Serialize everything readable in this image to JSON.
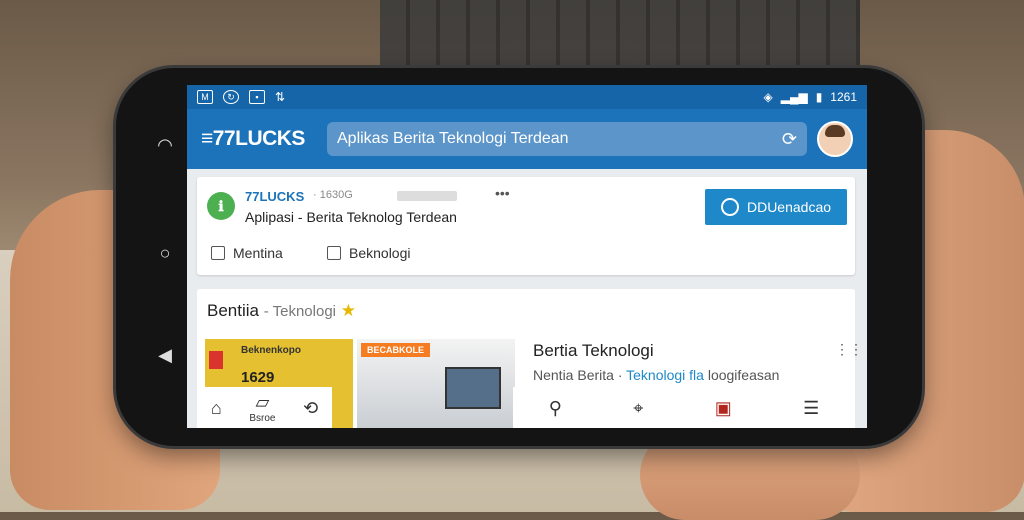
{
  "status_bar": {
    "left_icons": [
      "notification-icon",
      "sync-icon",
      "image-icon",
      "usb-icon"
    ],
    "time": "1261",
    "right_icons": [
      "wifi-icon",
      "signal-icon",
      "battery-icon"
    ]
  },
  "app_bar": {
    "logo": "≡77LUCKS",
    "search_text": "Aplikas Berita Teknologi Terdean"
  },
  "app_card": {
    "name": "77LUCKS",
    "meta": "· 1630G",
    "description": "Aplipasi - Berita Teknolog Terdean",
    "download_label": "DDUenadcao",
    "filters": [
      "Mentina",
      "Beknologi"
    ]
  },
  "section": {
    "title": "Bentiia",
    "subtitle": "Teknologi",
    "thumb1_label": "Beknenkopo",
    "thumb1_number": "1629",
    "thumb2_tag": "BECABKOLE",
    "article_title": "Bertia Teknologi",
    "article_sub_prefix": "Nentia Berita · ",
    "article_sub_highlight": "Teknologi fla",
    "article_sub_suffix": " loogifeasan"
  },
  "bottom_nav": {
    "left": [
      {
        "icon": "home-icon"
      },
      {
        "icon": "bookmark-icon",
        "label": "Bsroe"
      },
      {
        "icon": "share-icon"
      }
    ],
    "right": [
      {
        "icon": "search-icon"
      },
      {
        "icon": "tag-icon"
      },
      {
        "icon": "video-icon"
      },
      {
        "icon": "profile-icon"
      }
    ]
  }
}
